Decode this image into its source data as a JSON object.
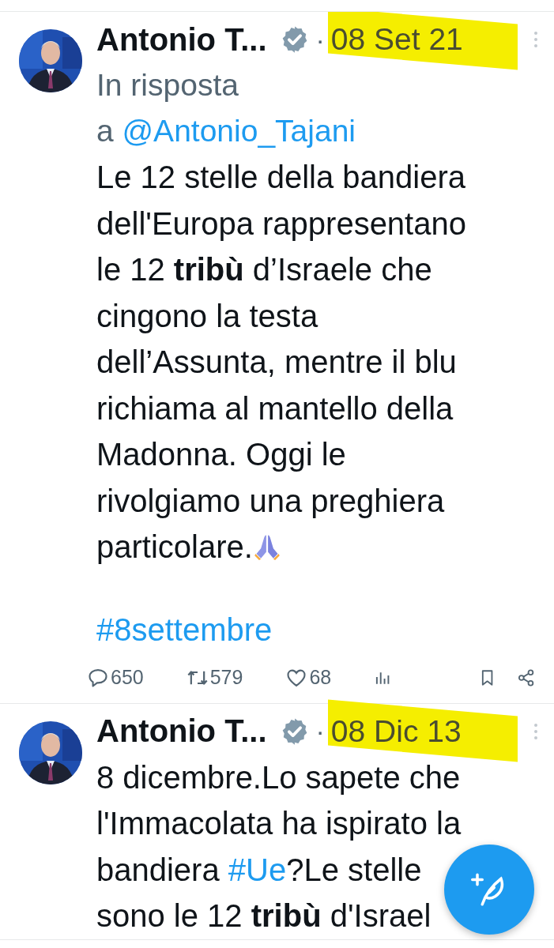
{
  "tweets": [
    {
      "author": "Antonio T...",
      "verified": true,
      "separator": "·",
      "date": "08 Set 21",
      "date_highlighted": true,
      "reply": {
        "prefix": "In risposta",
        "to": "a",
        "handle": "@Antonio_Tajani"
      },
      "body": [
        {
          "kind": "text",
          "text": "Le 12 stelle della bandiera dell'Europa rappresentano le 12 "
        },
        {
          "kind": "bold",
          "text": "tribù"
        },
        {
          "kind": "text",
          "text": " d’Israele che cingono la testa dell’Assunta, mentre il blu richiama al mantello della Madonna. Oggi le rivolgiamo una preghiera particolare."
        }
      ],
      "emoji": true,
      "hashtag": "#8settembre",
      "actions": {
        "replies": "650",
        "retweets": "579",
        "likes": "68"
      }
    },
    {
      "author": "Antonio T...",
      "verified": true,
      "separator": "·",
      "date": "08 Dic 13",
      "date_highlighted": true,
      "body": [
        {
          "kind": "text",
          "text": "8 dicembre.Lo sapete che l'Immacolata ha ispirato la bandiera "
        },
        {
          "kind": "link",
          "text": "#Ue"
        },
        {
          "kind": "text",
          "text": "?Le stelle sono le 12 "
        },
        {
          "kind": "bold",
          "text": "tribù"
        },
        {
          "kind": "text",
          "text": " d'Israel"
        }
      ]
    }
  ],
  "compose_button": true
}
